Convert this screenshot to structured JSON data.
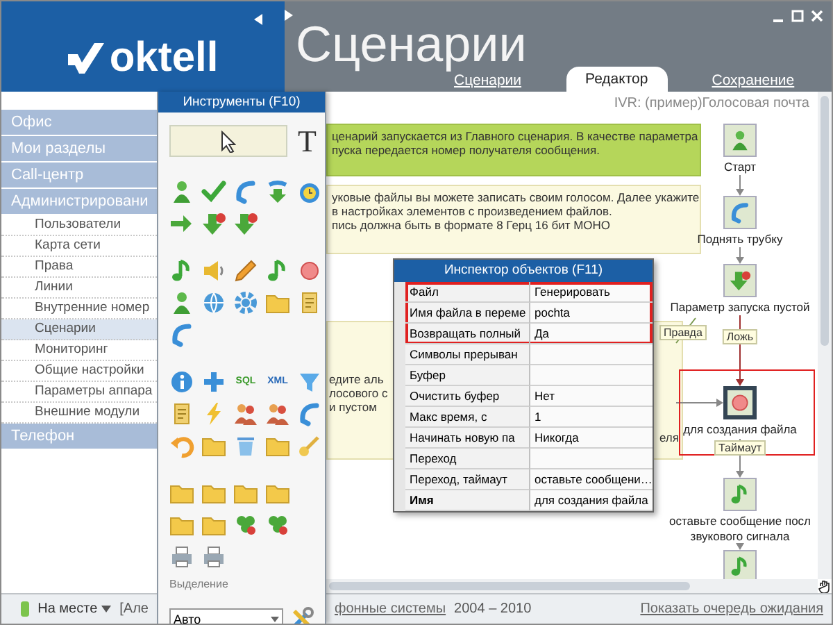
{
  "window": {
    "title": "Сценарии"
  },
  "header": {
    "logo": "oktell",
    "tabs": [
      {
        "label": "Сценарии",
        "selected": false
      },
      {
        "label": "Редактор",
        "selected": true
      },
      {
        "label": "Сохранение",
        "selected": false
      }
    ]
  },
  "sidebar": {
    "sections": [
      {
        "label": "Офис"
      },
      {
        "label": "Мои разделы"
      },
      {
        "label": "Call-центр"
      },
      {
        "label": "Администрировани",
        "children": [
          {
            "label": "Пользователи",
            "selected": false
          },
          {
            "label": "Карта сети",
            "selected": false
          },
          {
            "label": "Права",
            "selected": false
          },
          {
            "label": "Линии",
            "selected": false
          },
          {
            "label": "Внутренние номер",
            "selected": false
          },
          {
            "label": "Сценарии",
            "selected": true
          },
          {
            "label": "Мониторинг",
            "selected": false
          },
          {
            "label": "Общие настройки",
            "selected": false
          },
          {
            "label": "Параметры аппара",
            "selected": false
          },
          {
            "label": "Внешние модули",
            "selected": false
          }
        ]
      },
      {
        "label": "Телефон"
      }
    ]
  },
  "palette": {
    "title": "Инструменты (F10)",
    "text_tool": "T",
    "badges": [
      "SQL",
      "XML"
    ],
    "selection_label": "Выделение",
    "selection_value": "Авто"
  },
  "canvas": {
    "scenario": "IVR: (пример)Голосовая почта",
    "comments": [
      {
        "kind": "note",
        "lines": [
          "ценарий запускается из Главного сценария. В качестве параметра",
          "пуска передается номер получателя сообщения."
        ]
      },
      {
        "kind": "info",
        "lines": [
          "уковые файлы вы можете записать своим голосом. Далее укажите",
          "в настройках элементов с произведением файлов.",
          "пись должна быть в формате 8 Герц 16 бит МОНО"
        ]
      },
      {
        "kind": "info",
        "lines": [
          "едите аль",
          "лосового с",
          "и пустом"
        ],
        "trailing": "еля"
      }
    ],
    "nodes": [
      {
        "kind": "start",
        "lines": [
          "Старт"
        ],
        "selected": false,
        "highlighted": false
      },
      {
        "kind": "phone",
        "lines": [
          "Поднять трубку"
        ],
        "selected": false,
        "highlighted": false
      },
      {
        "kind": "condition",
        "lines": [
          "Параметр запуска пустой"
        ],
        "selected": false,
        "highlighted": false
      },
      {
        "kind": "record",
        "lines": [
          "для создания файла"
        ],
        "selected": true,
        "highlighted": true
      },
      {
        "kind": "play",
        "lines": [
          "оставьте сообщение посл",
          "звукового сигнала"
        ],
        "selected": false,
        "highlighted": false
      },
      {
        "kind": "play",
        "selected": false,
        "highlighted": false
      }
    ],
    "edge_labels": [
      "Ложь",
      "Правда",
      "Таймаут"
    ]
  },
  "inspector": {
    "title": "Инспектор объектов (F11)",
    "rows": [
      {
        "name": "Файл",
        "value": "Генерировать",
        "highlighted": true,
        "bold": false
      },
      {
        "name": "Имя файла в переме",
        "value": "pochta",
        "highlighted": true,
        "bold": false
      },
      {
        "name": "Возвращать полный",
        "value": "Да",
        "highlighted": true,
        "bold": false
      },
      {
        "name": "Символы прерыван",
        "highlighted": false,
        "bold": false
      },
      {
        "name": "Буфер",
        "highlighted": false,
        "bold": false
      },
      {
        "name": "Очистить буфер",
        "value": "Нет",
        "highlighted": false,
        "bold": false
      },
      {
        "name": "Макс время, с",
        "value": "1",
        "highlighted": false,
        "bold": false
      },
      {
        "name": "Начинать новую па",
        "value": "Никогда",
        "highlighted": false,
        "bold": false
      },
      {
        "name": "Переход",
        "highlighted": false,
        "bold": false
      },
      {
        "name": "Переход, таймаут",
        "value": "оставьте сообщени…",
        "highlighted": false,
        "bold": false
      },
      {
        "name": "Имя",
        "value": "для создания файла",
        "highlighted": false,
        "bold": true
      }
    ]
  },
  "status_bar": {
    "presence": "На месте",
    "user": "[Але",
    "company_link": "фонные системы",
    "years": "2004 – 2010",
    "queue_link": "Показать очередь ожидания"
  }
}
